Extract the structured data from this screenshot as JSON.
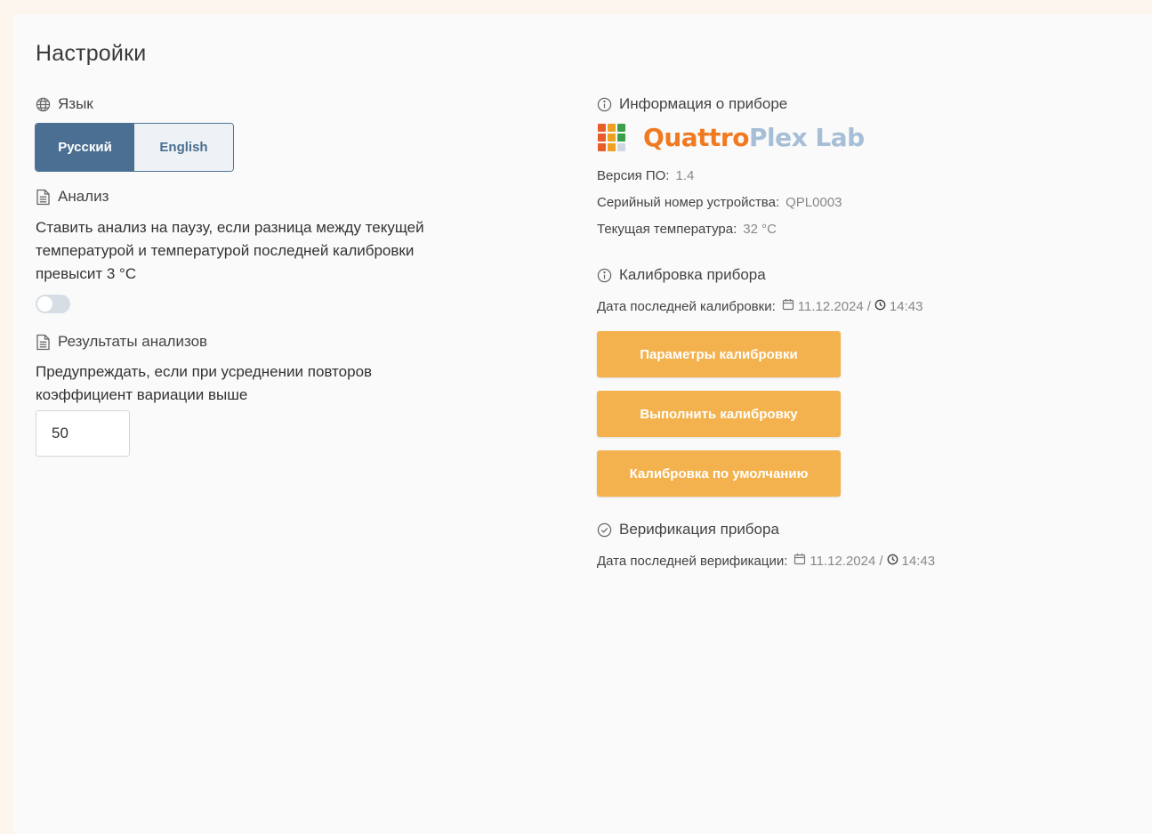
{
  "page": {
    "title": "Настройки"
  },
  "language": {
    "heading": "Язык",
    "options": [
      {
        "label": "Русский",
        "selected": true
      },
      {
        "label": "English",
        "selected": false
      }
    ]
  },
  "analysis": {
    "heading": "Анализ",
    "description": "Ставить анализ на паузу, если разница между текущей температурой и температурой последней калибровки превысит 3 °C",
    "pause_toggle_on": false
  },
  "results": {
    "heading": "Результаты анализов",
    "description": "Предупреждать, если при усреднении повторов коэффициент вариации выше",
    "cv_threshold": "50"
  },
  "device_info": {
    "heading": "Информация о приборе",
    "logo": {
      "first_letter": "Q",
      "part1": "uattro",
      "part2": "Plex Lab"
    },
    "logo_colors": [
      "#e85d2a",
      "#f0a020",
      "#3aa14a",
      "#e85d2a",
      "#f0a020",
      "#3aa14a",
      "#e85d2a",
      "#f0a020",
      "#cfd8e2"
    ],
    "software_version_label": "Версия ПО:",
    "software_version": "1.4",
    "serial_label": "Серийный номер устройства:",
    "serial": "QPL0003",
    "temperature_label": "Текущая температура:",
    "temperature": "32 °C"
  },
  "calibration": {
    "heading": "Калибровка прибора",
    "last_label": "Дата последней калибровки:",
    "last_date": "11.12.2024",
    "separator": "/",
    "last_time": "14:43",
    "buttons": {
      "params": "Параметры калибровки",
      "run": "Выполнить калибровку",
      "default": "Калибровка по умолчанию"
    }
  },
  "verification": {
    "heading": "Верификация прибора",
    "last_label": "Дата последней верификации:",
    "last_date": "11.12.2024",
    "separator": "/",
    "last_time": "14:43"
  },
  "colors": {
    "accent_blue": "#4a6f92",
    "accent_orange": "#f3b24e",
    "logo_orange": "#f07a22",
    "logo_blue": "#a6bed6"
  }
}
